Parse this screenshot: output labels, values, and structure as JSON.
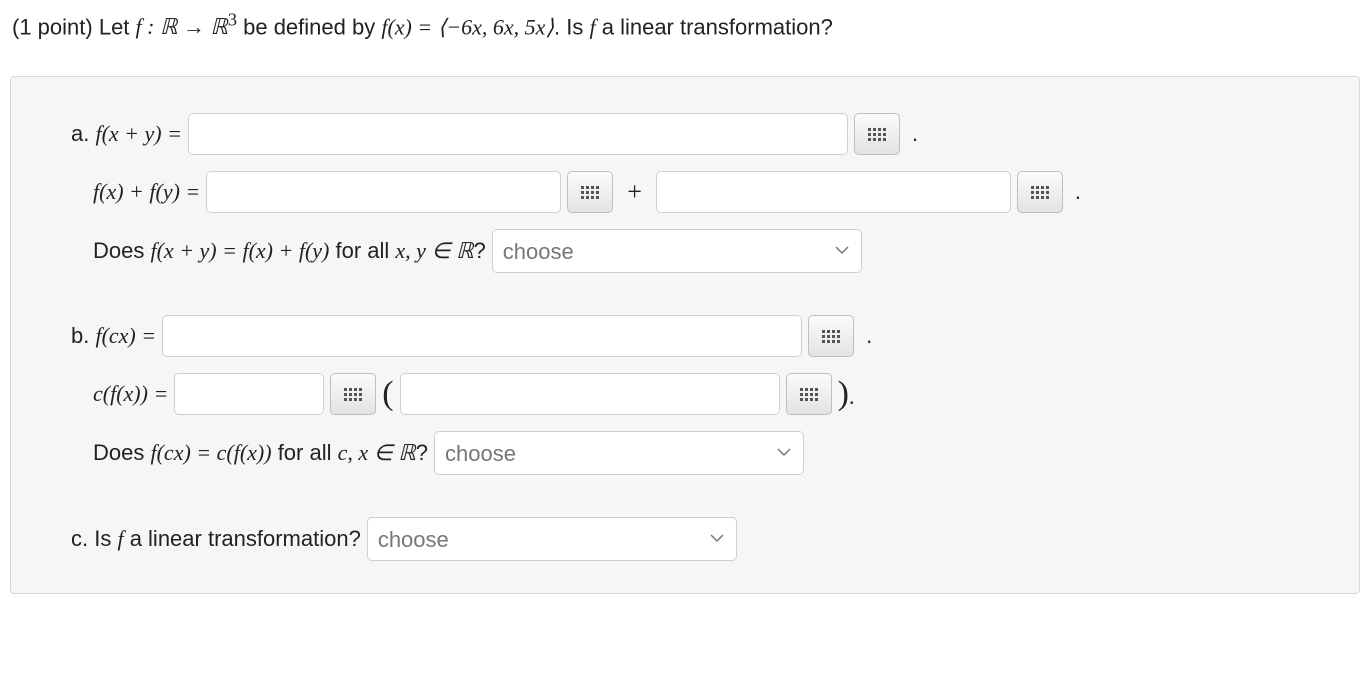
{
  "prompt": {
    "points": "(1 point)",
    "let": " Let ",
    "fmap": "f : ℝ → ℝ",
    "sup": "3",
    "defined": " be defined by ",
    "fx": "f(x) = ⟨−6x, 6x, 5x⟩",
    "tail": ". Is ",
    "fvar": "f",
    "q": " a linear transformation?"
  },
  "a": {
    "label1_pre": "a. ",
    "label1_math": "f(x + y) =",
    "label2_math": "f(x) + f(y) =",
    "plus": "+",
    "q_pre": "Does ",
    "q_math": "f(x + y) = f(x) + f(y)",
    "q_mid": " for all ",
    "q_xy": "x, y ∈ ℝ",
    "q_post": "?",
    "choose": "choose"
  },
  "b": {
    "label1_pre": "b. ",
    "label1_math": "f(cx) =",
    "label2_math": "c(f(x)) =",
    "lparen": "(",
    "rparen": ")",
    "q_pre": "Does ",
    "q_math": "f(cx) = c(f(x))",
    "q_mid": " for all ",
    "q_cx": "c, x ∈ ℝ",
    "q_post": "?",
    "choose": "choose"
  },
  "c": {
    "label_pre": "c. Is ",
    "fvar": "f",
    "label_post": " a linear transformation?",
    "choose": "choose"
  },
  "period": "."
}
